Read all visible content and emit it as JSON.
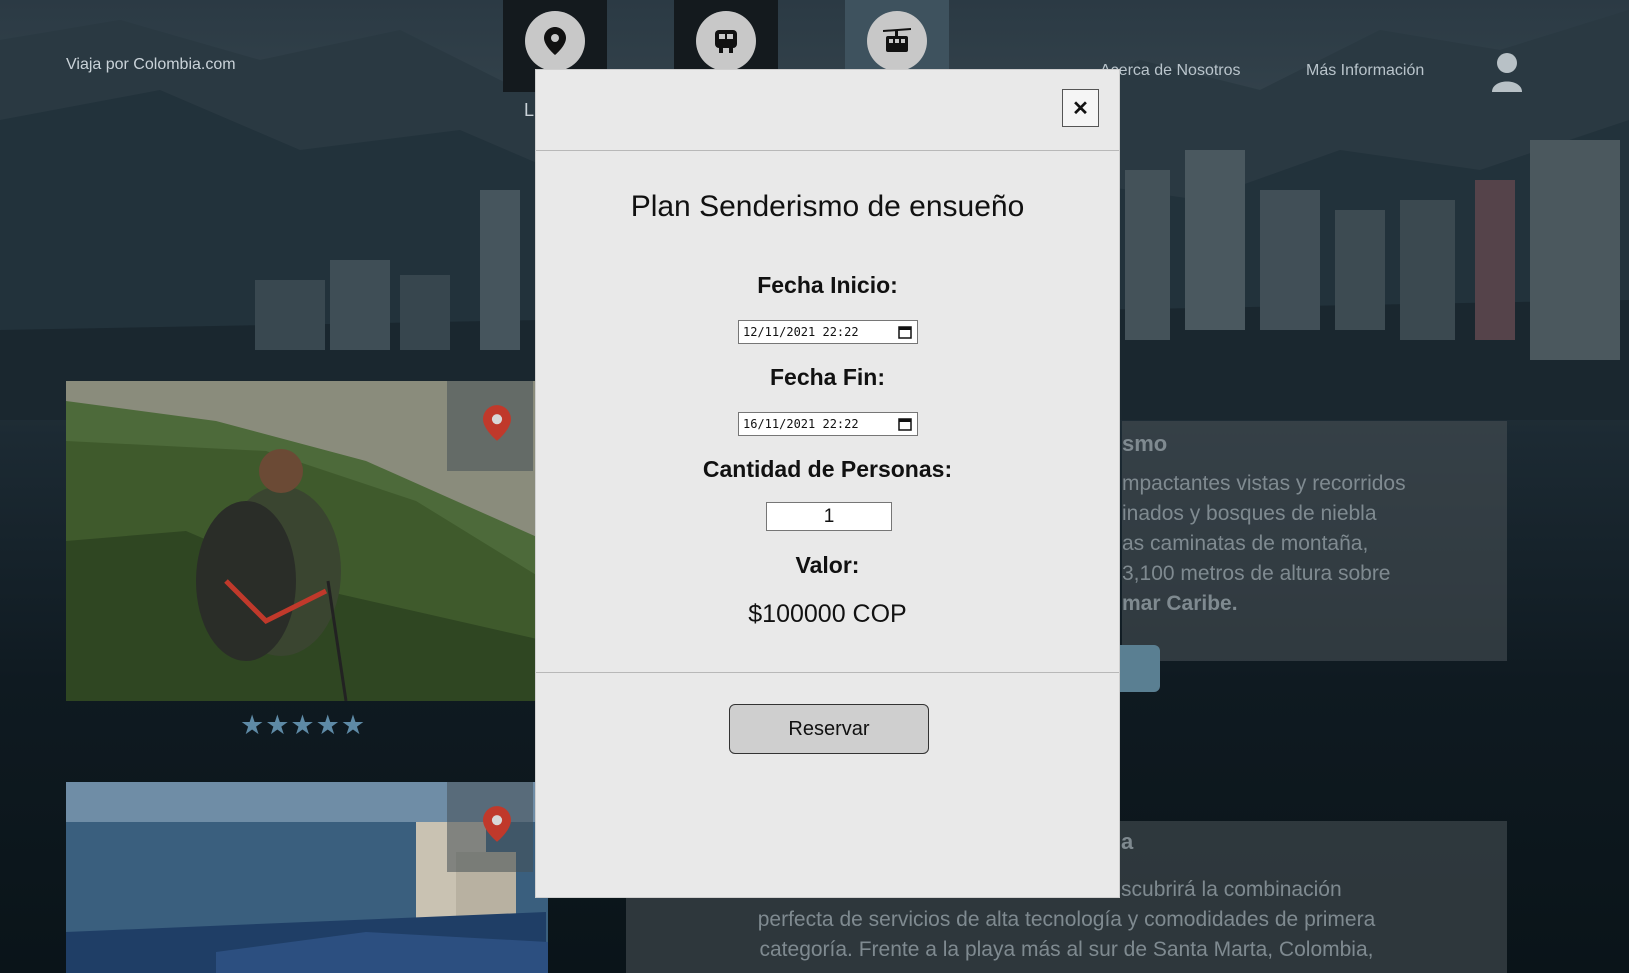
{
  "header": {
    "brand": "Viaja por Colombia.com",
    "nav_icons": [
      "location-pin-icon",
      "bus-icon",
      "cable-car-icon"
    ],
    "nav_peek_letter": "L",
    "links": [
      "Acerca de Nosotros",
      "Más Información"
    ]
  },
  "cards": [
    {
      "title_fragment": "smo",
      "text_lines": [
        "mpactantes vistas y recorridos",
        "inados y bosques de niebla",
        "as caminatas de montaña,",
        "3,100 metros de altura sobre"
      ],
      "text_bold_fragment": "mar Caribe.",
      "rating_stars": "★★★★★"
    },
    {
      "title_fragment": "a",
      "text_lines": [
        "í descubrirá la combinación",
        "perfecta de servicios de alta tecnología y comodidades de primera",
        "categoría. Frente a la playa más al sur de Santa Marta, Colombia,"
      ]
    }
  ],
  "modal": {
    "title": "Plan Senderismo de ensueño",
    "start_label": "Fecha Inicio:",
    "start_value": "12/11/2021 22:22",
    "end_label": "Fecha Fin:",
    "end_value": "16/11/2021 22:22",
    "people_label": "Cantidad de Personas:",
    "people_value": "1",
    "value_label": "Valor:",
    "price": "$100000 COP",
    "reserve_button": "Reservar",
    "close_glyph": "✕"
  },
  "colors": {
    "modal_bg": "#e9e9e9",
    "star_color": "#5e8aa6",
    "pin_red": "#c0392b"
  }
}
